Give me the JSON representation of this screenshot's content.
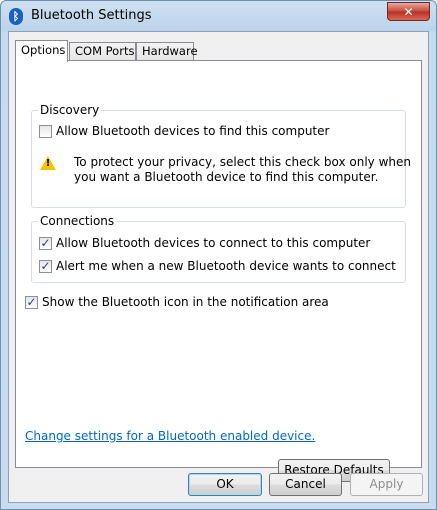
{
  "window": {
    "title": "Bluetooth Settings",
    "icon": "bluetooth-icon",
    "icon_glyph": "ᛒ",
    "close_glyph": "✕"
  },
  "tabs": [
    {
      "label": "Options",
      "active": true
    },
    {
      "label": "COM Ports",
      "active": false
    },
    {
      "label": "Hardware",
      "active": false
    }
  ],
  "discovery": {
    "title": "Discovery",
    "allow_find": {
      "label": "Allow Bluetooth devices to find this computer",
      "checked": false
    },
    "warning_icon": "warning-icon",
    "warning_line1": "To protect your privacy, select this check box only when",
    "warning_line2": "you want a Bluetooth device to find this computer."
  },
  "connections": {
    "title": "Connections",
    "allow_connect": {
      "label": "Allow Bluetooth devices to connect to this computer",
      "checked": true
    },
    "alert_new": {
      "label": "Alert me when a new Bluetooth device wants to connect",
      "checked": true
    }
  },
  "show_icon": {
    "label": "Show the Bluetooth icon in the notification area",
    "checked": true
  },
  "link_text": "Change settings for a Bluetooth enabled device.",
  "buttons": {
    "restore": "Restore Defaults",
    "ok": "OK",
    "cancel": "Cancel",
    "apply": "Apply"
  }
}
